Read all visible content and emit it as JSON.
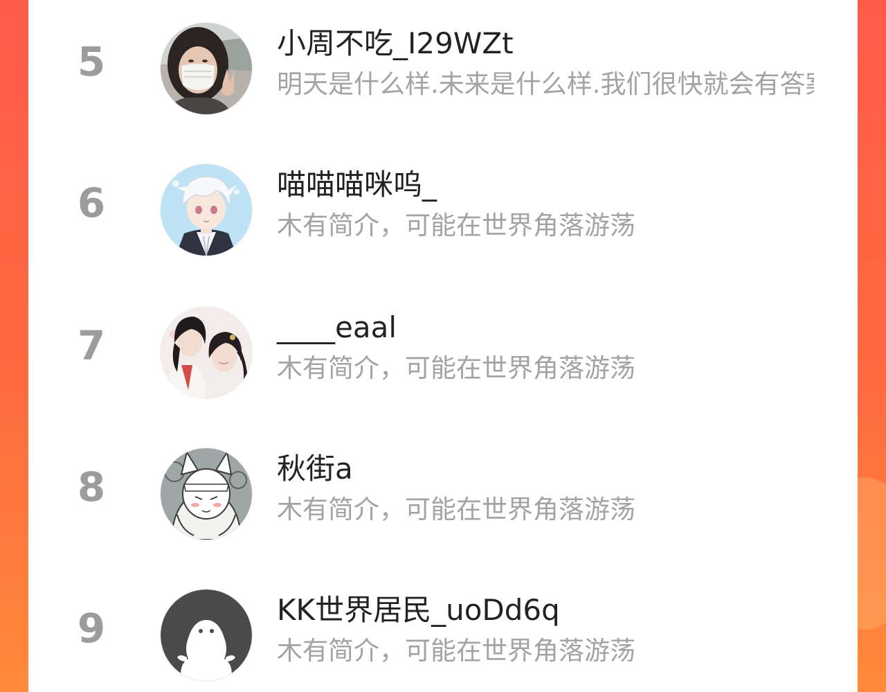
{
  "users": [
    {
      "rank": "5",
      "name": "小周不吃_I29WZt",
      "bio": "明天是什么样.未来是什么样.我们很快就会有答案",
      "avatar_icon": "photo-girl-mask-avatar"
    },
    {
      "rank": "6",
      "name": "喵喵喵咪呜_",
      "bio": "木有简介，可能在世界角落游荡",
      "avatar_icon": "anime-white-hair-boy-avatar"
    },
    {
      "rank": "7",
      "name": "____eaal",
      "bio": "木有简介，可能在世界角落游荡",
      "avatar_icon": "anime-couple-avatar"
    },
    {
      "rank": "8",
      "name": "秋街a",
      "bio": "木有简介，可能在世界角落游荡",
      "avatar_icon": "sketch-fox-girl-avatar"
    },
    {
      "rank": "9",
      "name": "KK世界居民_uoDd6q",
      "bio": "木有简介，可能在世界角落游荡",
      "avatar_icon": "default-ghost-avatar"
    }
  ],
  "colors": {
    "background_top": "#ff5b4a",
    "background_bottom": "#ff8a3a",
    "card": "#ffffff",
    "rank_text": "#9c9c9c",
    "name_text": "#222222",
    "bio_text": "#a3a3a3"
  }
}
